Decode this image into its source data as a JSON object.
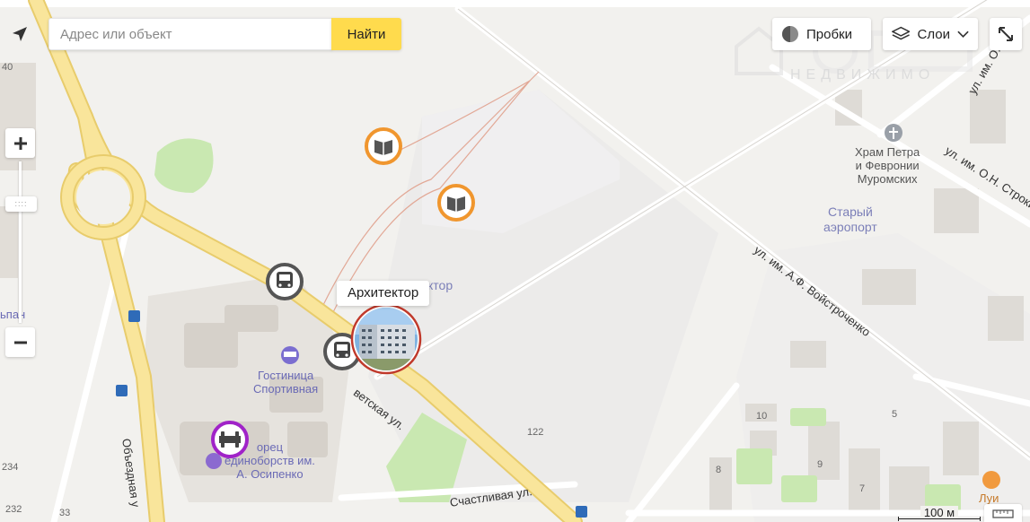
{
  "search": {
    "placeholder": "Адрес или объект",
    "button_label": "Найти"
  },
  "controls": {
    "traffic_label": "Пробки",
    "layers_label": "Слои",
    "zoom_in": "+",
    "zoom_out": "−",
    "zoom_handle": "::::",
    "icons": [
      "locate-arrow-icon",
      "traffic-light-icon",
      "layers-icon",
      "chevron-down-icon",
      "fullscreen-icon",
      "plus-icon",
      "minus-icon",
      "ruler-icon"
    ]
  },
  "tooltip": {
    "label": "Архитектор"
  },
  "scale": {
    "label": "100 м"
  },
  "streets": {
    "sovetskaya": "ветская ул.",
    "obezdnaya": "Объездная у",
    "schastlivaya": "Счастливая ул.",
    "voystrochenko": "ул. им. А.Ф. Войстроченко",
    "stroki": "ул. им. О.Н. Строки",
    "os": "ул. им. О.С"
  },
  "pois": {
    "hotel": "Гостиница\nСпортивная",
    "palace": "орец\nединоборств им.\nА. Осипенко",
    "church": "Храм Петра\nи Февронии\nМуромских",
    "district": "Старый\nаэропорт",
    "arkhitektor_partial": "ктор",
    "cafe_partial": "Луи",
    "left_partial": "ьпан"
  },
  "house_numbers": [
    "40",
    "122",
    "10",
    "5",
    "8",
    "9",
    "7",
    "234",
    "232",
    "33"
  ],
  "watermark": "НЕДВИЖИМО",
  "colors": {
    "search_button": "#ffdb4d",
    "main_road": "#f9e59b",
    "education_marker": "#f0962e",
    "transport_marker": "#555555",
    "sport_marker": "#a023c8",
    "selected_marker_border": "#c0392b",
    "poi_text": "#6a6ab5"
  }
}
